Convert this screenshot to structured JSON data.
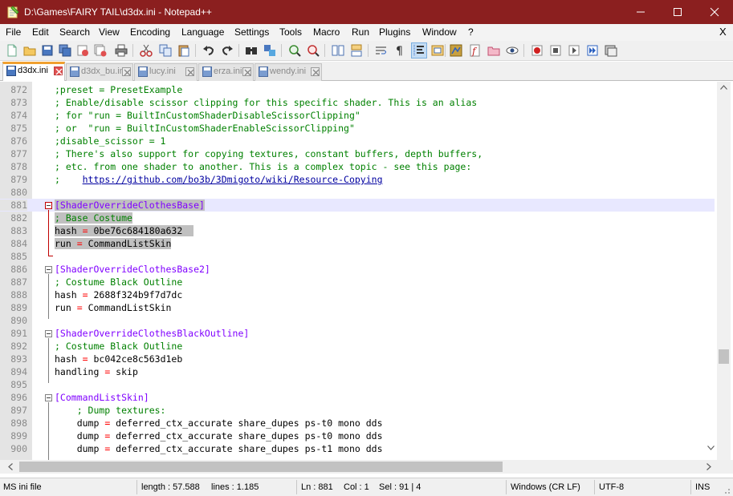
{
  "window": {
    "title": "D:\\Games\\FAIRY TAIL\\d3dx.ini - Notepad++"
  },
  "menu": {
    "items": [
      "File",
      "Edit",
      "Search",
      "View",
      "Encoding",
      "Language",
      "Settings",
      "Tools",
      "Macro",
      "Run",
      "Plugins",
      "Window",
      "?"
    ],
    "close_doc": "X"
  },
  "toolbar": {
    "icons": [
      "new-file-icon",
      "open-file-icon",
      "save-icon",
      "save-all-icon",
      "close-icon",
      "close-all-icon",
      "print-icon",
      "cut-icon",
      "copy-icon",
      "paste-icon",
      "undo-icon",
      "redo-icon",
      "find-icon",
      "replace-icon",
      "zoom-in-icon",
      "zoom-out-icon",
      "sync-vertical-icon",
      "sync-horizontal-icon",
      "word-wrap-icon",
      "show-all-characters-icon",
      "indent-guide-icon",
      "user-language-icon",
      "document-map-icon",
      "function-list-icon",
      "folder-as-workspace-icon",
      "monitoring-icon",
      "record-macro-icon",
      "stop-recording-icon",
      "playback-macro-icon",
      "run-macro-multiple-icon",
      "save-macro-icon"
    ]
  },
  "tabs": [
    {
      "label": "d3dx.ini",
      "active": true
    },
    {
      "label": "d3dx_bu.ini",
      "active": false
    },
    {
      "label": "lucy.ini",
      "active": false
    },
    {
      "label": "erza.ini",
      "active": false
    },
    {
      "label": "wendy.ini",
      "active": false
    }
  ],
  "editor": {
    "lines": [
      {
        "n": "872",
        "t": ";preset = PresetExample"
      },
      {
        "n": "873",
        "t": "; Enable/disable scissor clipping for this specific shader. This is an alias"
      },
      {
        "n": "874",
        "t": "; for \"run = BuiltInCustomShaderDisableScissorClipping\""
      },
      {
        "n": "875",
        "t": "; or  \"run = BuiltInCustomShaderEnableScissorClipping\""
      },
      {
        "n": "876",
        "t": ";disable_scissor = 1"
      },
      {
        "n": "877",
        "t": "; There's also support for copying textures, constant buffers, depth buffers,"
      },
      {
        "n": "878",
        "t": "; etc. from one shader to another. This is a complex topic - see this page:"
      },
      {
        "n": "879",
        "t": ";    https://github.com/bo3b/3Dmigoto/wiki/Resource-Copying"
      },
      {
        "n": "880",
        "t": ""
      },
      {
        "n": "881",
        "t": "[ShaderOverrideClothesBase]"
      },
      {
        "n": "882",
        "t": "; Base Costume"
      },
      {
        "n": "883",
        "t": "hash = 0be76c684180a632"
      },
      {
        "n": "884",
        "t": "run = CommandListSkin"
      },
      {
        "n": "885",
        "t": ""
      },
      {
        "n": "886",
        "t": "[ShaderOverrideClothesBase2]"
      },
      {
        "n": "887",
        "t": "; Costume Black Outline"
      },
      {
        "n": "888",
        "t": "hash = 2688f324b9f7d7dc"
      },
      {
        "n": "889",
        "t": "run = CommandListSkin"
      },
      {
        "n": "890",
        "t": ""
      },
      {
        "n": "891",
        "t": "[ShaderOverrideClothesBlackOutline]"
      },
      {
        "n": "892",
        "t": "; Costume Black Outline"
      },
      {
        "n": "893",
        "t": "hash = bc042ce8c563d1eb"
      },
      {
        "n": "894",
        "t": "handling = skip"
      },
      {
        "n": "895",
        "t": ""
      },
      {
        "n": "896",
        "t": "[CommandListSkin]"
      },
      {
        "n": "897",
        "t": "    ; Dump textures:"
      },
      {
        "n": "898",
        "t": "    dump = deferred_ctx_accurate share_dupes ps-t0 mono dds"
      },
      {
        "n": "899",
        "t": "    dump = deferred_ctx_accurate share_dupes ps-t0 mono dds"
      },
      {
        "n": "900",
        "t": "    dump = deferred_ctx_accurate share_dupes ps-t1 mono dds"
      }
    ]
  },
  "status": {
    "language": "MS ini file",
    "length": "length : 57.588",
    "lines": "lines : 1.185",
    "ln": "Ln : 881",
    "col": "Col : 1",
    "sel": "Sel : 91 | 4",
    "eol": "Windows (CR LF)",
    "encoding": "UTF-8",
    "mode": "INS"
  },
  "colors": {
    "titlebar": "#8b1f1f",
    "comment": "#008000",
    "section": "#8000ff",
    "operator": "#ff0000",
    "current_line": "#e8e8ff",
    "selection": "#c0c0c0",
    "active_tab_accent": "#f0a030"
  }
}
